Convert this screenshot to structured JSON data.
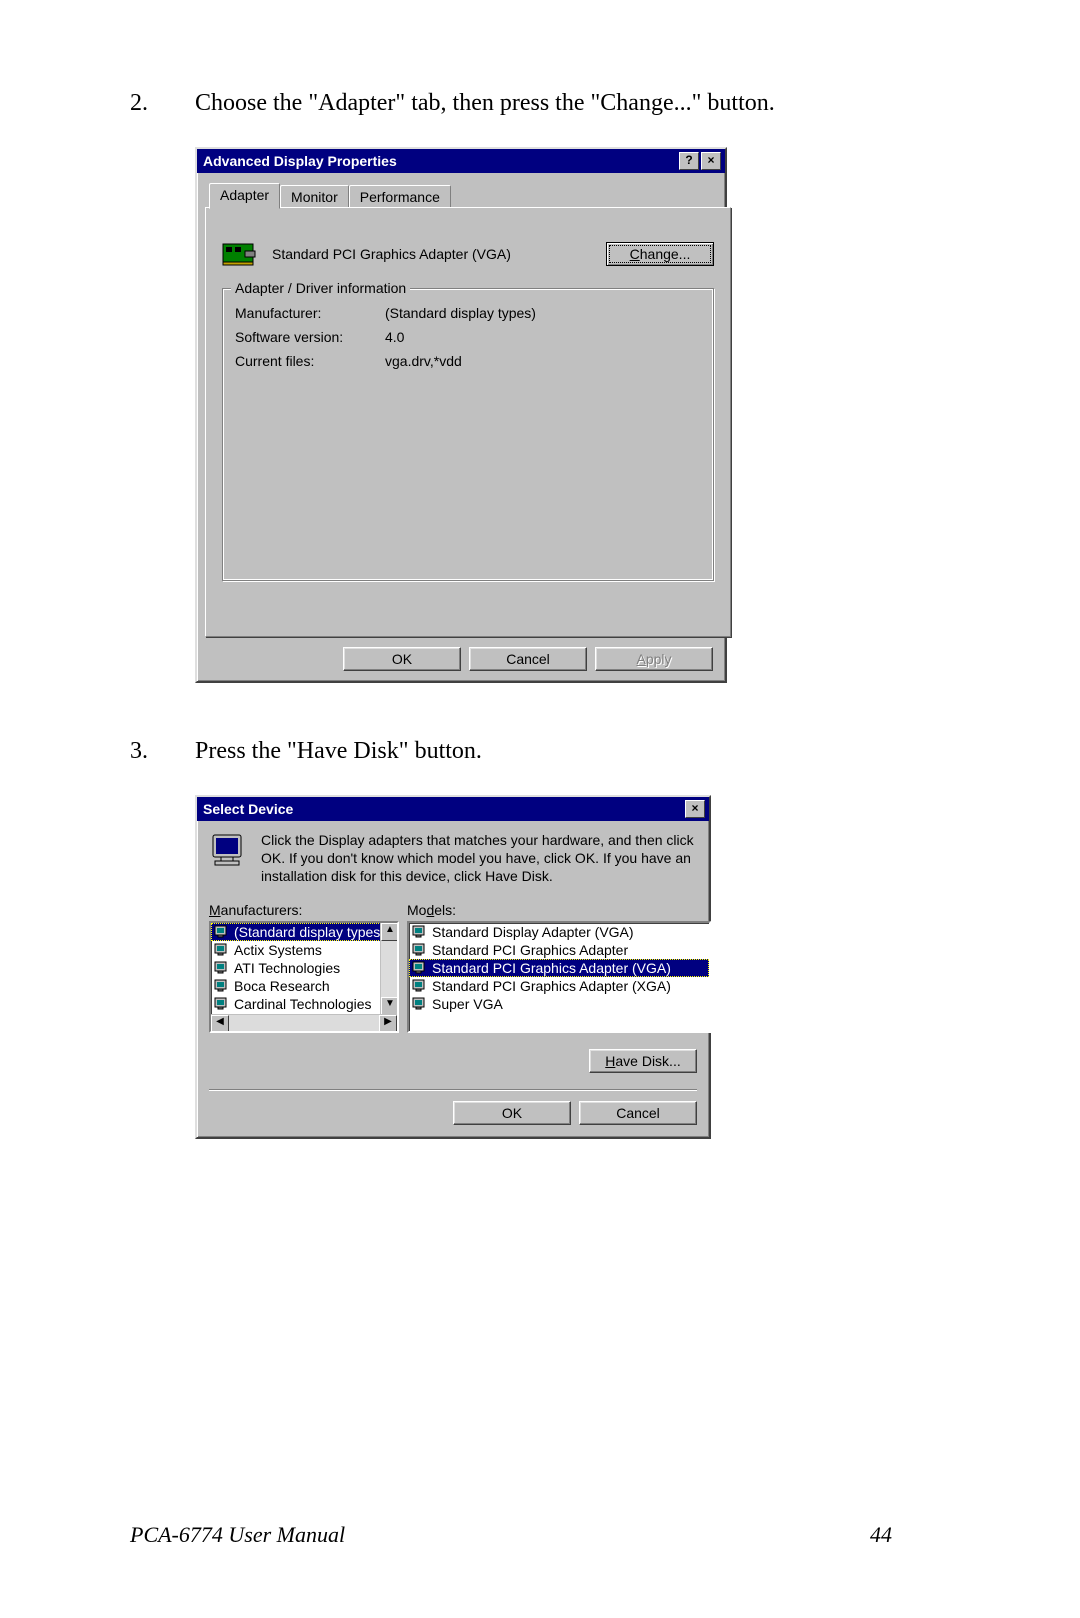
{
  "steps": {
    "s2": {
      "num": "2.",
      "text": "Choose the \"Adapter\" tab, then press the \"Change...\" button."
    },
    "s3": {
      "num": "3.",
      "text": "Press the \"Have Disk\" button."
    }
  },
  "dialog1": {
    "title": "Advanced Display Properties",
    "help_btn": "?",
    "close_btn": "×",
    "tabs": {
      "adapter": "Adapter",
      "monitor": "Monitor",
      "performance": "Performance"
    },
    "adapter_name": "Standard PCI Graphics Adapter (VGA)",
    "change_btn": "Change...",
    "group_title": "Adapter / Driver information",
    "rows": {
      "manu_label": "Manufacturer:",
      "manu_value": "(Standard display types)",
      "ver_label": "Software version:",
      "ver_value": "4.0",
      "files_label": "Current files:",
      "files_value": "vga.drv,*vdd"
    },
    "ok": "OK",
    "cancel": "Cancel",
    "apply": "Apply"
  },
  "dialog2": {
    "title": "Select Device",
    "close_btn": "×",
    "instructions": "Click the Display adapters that matches your hardware, and then click OK. If you don't know which model you have, click OK. If you have an installation disk for this device, click Have Disk.",
    "manu_label": "Manufacturers:",
    "models_label": "Models:",
    "manufacturers": [
      "(Standard display types)",
      "Actix Systems",
      "ATI Technologies",
      "Boca Research",
      "Cardinal Technologies"
    ],
    "manu_selected_index": 0,
    "models": [
      "Standard Display Adapter (VGA)",
      "Standard PCI Graphics Adapter",
      "Standard PCI Graphics Adapter (VGA)",
      "Standard PCI Graphics Adapter (XGA)",
      "Super VGA"
    ],
    "model_selected_index": 2,
    "have_disk": "Have Disk...",
    "ok": "OK",
    "cancel": "Cancel"
  },
  "footer": {
    "manual": "PCA-6774 User Manual",
    "page": "44"
  }
}
